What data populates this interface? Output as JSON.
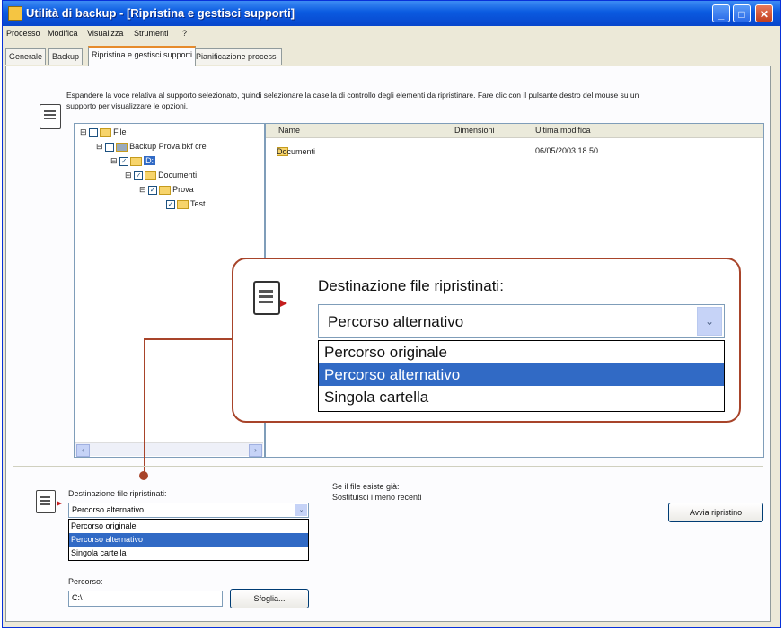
{
  "window": {
    "title": "Utilità di backup - [Ripristina e gestisci supporti]",
    "min_glyph": "_",
    "max_glyph": "□",
    "close_glyph": "✕"
  },
  "menu": [
    "Processo",
    "Modifica",
    "Visualizza",
    "Strumenti",
    "?"
  ],
  "tabs": [
    "Generale",
    "Backup",
    "Ripristina e gestisci supporti",
    "Pianificazione processi"
  ],
  "description": "Espandere la voce relativa al supporto selezionato, quindi selezionare la casella di controllo degli elementi da ripristinare. Fare clic con il pulsante destro del mouse su un supporto per visualizzare le opzioni.",
  "tree": {
    "nodes": [
      {
        "label": "File"
      },
      {
        "label": "Backup Prova.bkf cre"
      },
      {
        "label": "D:"
      },
      {
        "label": "Documenti"
      },
      {
        "label": "Prova"
      },
      {
        "label": "Test"
      }
    ],
    "scroll_left": "‹",
    "scroll_right": "›"
  },
  "list": {
    "columns": [
      "Name",
      "Dimensioni",
      "Ultima modifica"
    ],
    "rows": [
      {
        "name": "Documenti",
        "size": "",
        "modified": "06/05/2003 18.50"
      }
    ]
  },
  "callout": {
    "label": "Destinazione file ripristinati:",
    "selected": "Percorso alternativo",
    "options": [
      "Percorso originale",
      "Percorso alternativo",
      "Singola cartella"
    ],
    "selected_index": 1,
    "border_color": "#a8442a"
  },
  "restore_dest": {
    "label": "Destinazione file ripristinati:",
    "selected": "Percorso alternativo",
    "options": [
      "Percorso originale",
      "Percorso alternativo",
      "Singola cartella"
    ],
    "selected_index": 1
  },
  "existing": {
    "label": "Se il file esiste già:",
    "value": "Sostituisci i meno recenti"
  },
  "path": {
    "label": "Percorso:",
    "value": "C:\\",
    "browse_label": "Sfoglia..."
  },
  "start_button": "Avvia ripristino",
  "glyphs": {
    "checked": "✓",
    "expand": "⊟",
    "dropdown": "⌄"
  }
}
